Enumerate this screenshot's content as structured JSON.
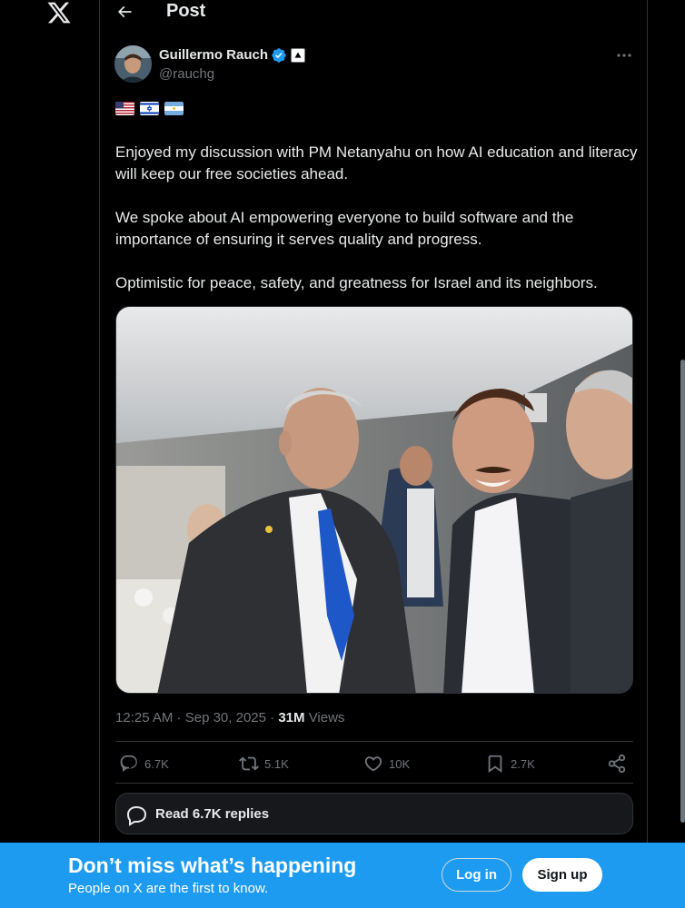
{
  "header": {
    "title": "Post"
  },
  "author": {
    "name": "Guillermo Rauch",
    "handle": "@rauchg"
  },
  "tweet": {
    "flags": [
      "US flag",
      "Israel flag",
      "Argentina flag"
    ],
    "paragraphs": [
      "Enjoyed my discussion with PM Netanyahu on how AI education and literacy will keep our free societies ahead.",
      "We spoke about AI empowering everyone to build software and the importance of ensuring it serves quality and progress.",
      "Optimistic for peace, safety, and greatness for Israel and its neighbors."
    ]
  },
  "meta": {
    "time": "12:25 AM",
    "separator": " · ",
    "date": "Sep 30, 2025",
    "views_count": "31M",
    "views_label": "Views"
  },
  "actions": {
    "replies": "6.7K",
    "reposts": "5.1K",
    "likes": "10K",
    "bookmarks": "2.7K"
  },
  "read_replies": {
    "label": "Read 6.7K replies"
  },
  "banner": {
    "title": "Don’t miss what’s happening",
    "subtitle": "People on X are the first to know.",
    "login_label": "Log in",
    "signup_label": "Sign up"
  },
  "colors": {
    "accent": "#1d9bf0",
    "background": "#000000",
    "muted": "#71767b"
  }
}
